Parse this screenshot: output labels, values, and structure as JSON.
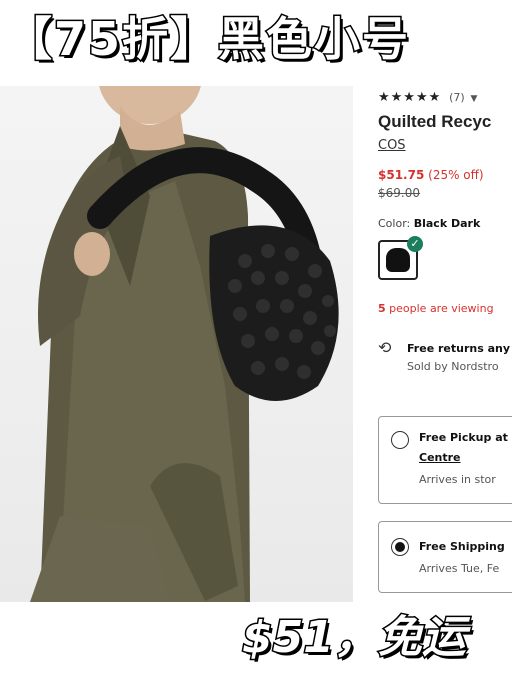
{
  "banner": {
    "title": "【75折】黑色小号"
  },
  "product": {
    "rating_count": "(7)",
    "title": "Quilted Recyc",
    "brand": "COS",
    "price": "$51.75",
    "discount": "(25% off)",
    "original_price": "$69.00",
    "color_label": "Color:",
    "color_value": "Black Dark",
    "viewing_count": "5",
    "viewing_text": "people are viewing",
    "returns_title": "Free returns any",
    "returns_sub": "Sold by Nordstro"
  },
  "delivery": {
    "pickup_title": "Free Pickup at",
    "pickup_store": "Centre",
    "pickup_sub": "Arrives in stor",
    "shipping_title": "Free Shipping",
    "shipping_sub": "Arrives Tue, Fe"
  },
  "overlay": {
    "price_note": "$51，免运"
  },
  "icons": {
    "star": "star-icon",
    "chevron": "chevron-down-icon",
    "check": "check-icon",
    "returns": "package-return-icon"
  },
  "colors": {
    "sale": "#d6322e",
    "check": "#1a7f5a",
    "jacket": "#5b5842"
  }
}
